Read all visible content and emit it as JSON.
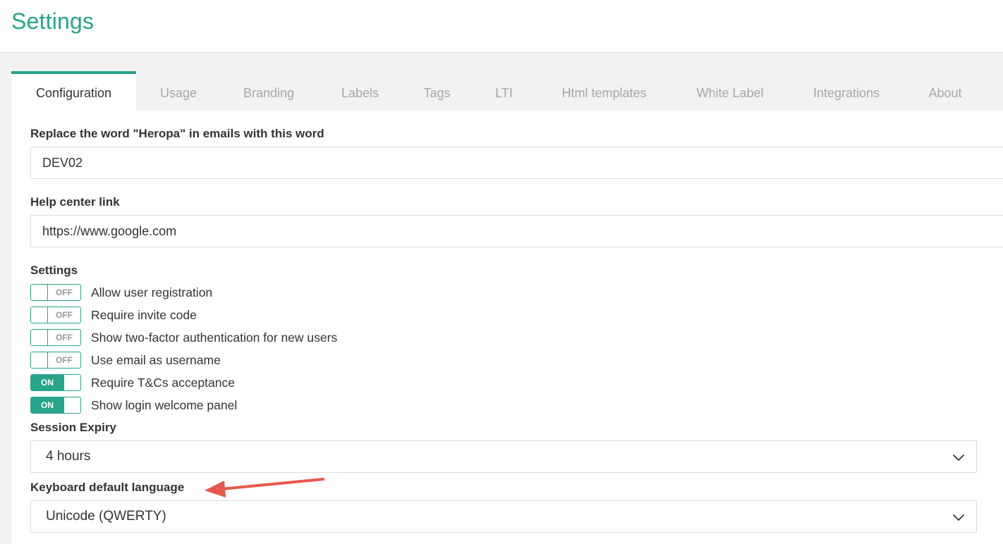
{
  "page": {
    "title": "Settings"
  },
  "tabs": [
    {
      "label": "Configuration",
      "active": true
    },
    {
      "label": "Usage"
    },
    {
      "label": "Branding"
    },
    {
      "label": "Labels"
    },
    {
      "label": "Tags"
    },
    {
      "label": "LTI"
    },
    {
      "label": "Html templates"
    },
    {
      "label": "White Label"
    },
    {
      "label": "Integrations"
    },
    {
      "label": "About"
    }
  ],
  "config": {
    "email_word": {
      "label": "Replace the word \"Heropa\" in emails with this word",
      "value": "DEV02"
    },
    "help_link": {
      "label": "Help center link",
      "value": "https://www.google.com"
    },
    "settings_label": "Settings",
    "toggles": [
      {
        "label": "Allow user registration",
        "state": "OFF"
      },
      {
        "label": "Require invite code",
        "state": "OFF"
      },
      {
        "label": "Show two-factor authentication for new users",
        "state": "OFF"
      },
      {
        "label": "Use email as username",
        "state": "OFF"
      },
      {
        "label": "Require T&Cs acceptance",
        "state": "ON"
      },
      {
        "label": "Show login welcome panel",
        "state": "ON"
      }
    ],
    "session_expiry": {
      "label": "Session Expiry",
      "value": "4 hours"
    },
    "keyboard_language": {
      "label": "Keyboard default language",
      "value": "Unicode (QWERTY)"
    }
  },
  "colors": {
    "accent": "#26a48c",
    "annotation_arrow": "#e8584a"
  },
  "icons": {
    "select_chevron": "chevron-down-icon",
    "annotation": "red-arrow-annotation"
  }
}
